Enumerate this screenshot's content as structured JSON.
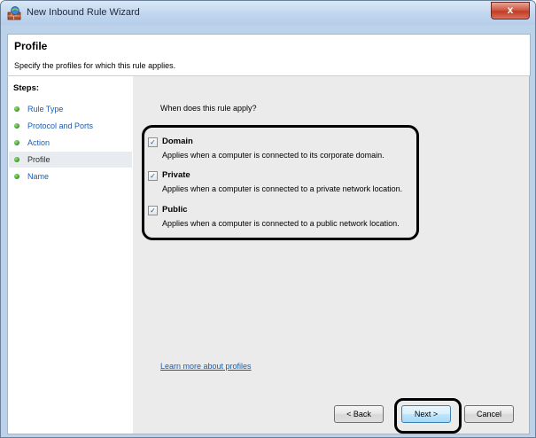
{
  "window": {
    "title": "New Inbound Rule Wizard",
    "close_glyph": "x"
  },
  "header": {
    "title": "Profile",
    "subtitle": "Specify the profiles for which this rule applies."
  },
  "steps": {
    "title": "Steps:",
    "items": [
      {
        "label": "Rule Type",
        "current": false
      },
      {
        "label": "Protocol and Ports",
        "current": false
      },
      {
        "label": "Action",
        "current": false
      },
      {
        "label": "Profile",
        "current": true
      },
      {
        "label": "Name",
        "current": false
      }
    ]
  },
  "content": {
    "question": "When does this rule apply?",
    "options": [
      {
        "label": "Domain",
        "checked": true,
        "description": "Applies when a computer is connected to its corporate domain."
      },
      {
        "label": "Private",
        "checked": true,
        "description": "Applies when a computer is connected to a private network location."
      },
      {
        "label": "Public",
        "checked": true,
        "description": "Applies when a computer is connected to a public network location."
      }
    ],
    "checkmark": "✓",
    "learn_more": "Learn more about profiles"
  },
  "buttons": {
    "back": "< Back",
    "next": "Next >",
    "cancel": "Cancel"
  },
  "icons": {
    "app": "firewall-wall-icon",
    "close": "close-icon",
    "step": "green-dot-icon",
    "checkbox": "checkbox-checked-icon"
  },
  "colors": {
    "link": "#1a5db0",
    "step_dot": "#3aa52a",
    "close": "#c23b25",
    "titlebar": "#c3d8ef",
    "content_bg": "#ebebeb",
    "annotation": "#000000"
  }
}
